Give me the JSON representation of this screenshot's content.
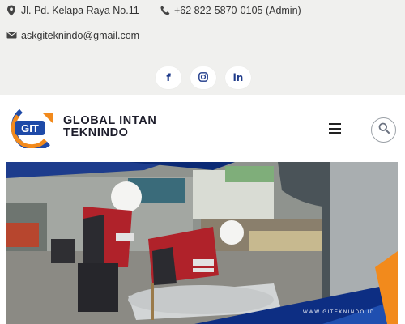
{
  "contact": {
    "address": "Jl. Pd. Kelapa Raya No.11",
    "phone": "+62 822-5870-0105 (Admin)",
    "email": "askgiteknindo@gmail.com"
  },
  "social": {
    "facebook": "f",
    "instagram": "◎",
    "linkedin": "in"
  },
  "brand": {
    "logo_text": "GIT",
    "name_line1": "GLOBAL INTAN",
    "name_line2": "TEKNINDO"
  },
  "hero": {
    "caption": "WWW.GITEKNINDO.ID"
  },
  "colors": {
    "navy": "#1e3a8a",
    "orange": "#f28a1c",
    "topbar": "#f0f0ee"
  }
}
